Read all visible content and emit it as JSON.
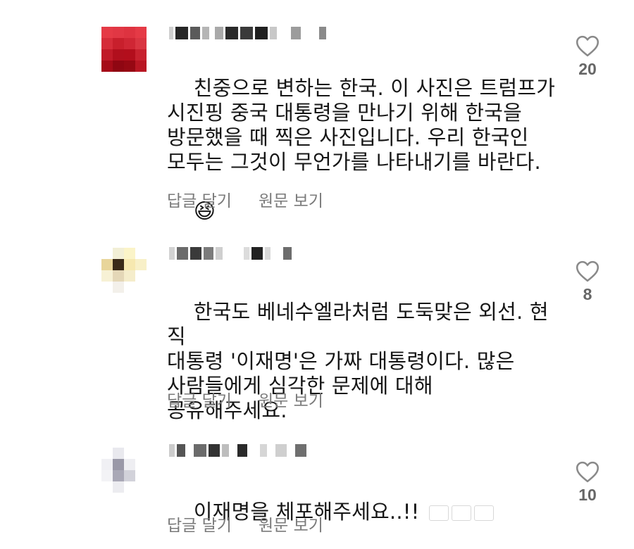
{
  "comments": [
    {
      "text": "친중으로 변하는 한국. 이 사진은 트럼프가\n시진핑 중국 대통령을 만나기 위해 한국을\n방문했을 때 찍은 사진입니다. 우리 한국인\n모두는 그것이 무언가를 나타내기를 바란다.",
      "emoji": "😆",
      "reply": "답글 달기",
      "translate": "원문 보기",
      "likes": "20"
    },
    {
      "text": "한국도 베네수엘라처럼 도둑맞은 외선. 현직\n대통령 '이재명'은 가짜 대통령이다. 많은\n사람들에게 심각한 문제에 대해\n공유해주세요.",
      "reply": "답글 달기",
      "translate": "원문 보기",
      "likes": "8"
    },
    {
      "text": "이재명을 체포해주세요..!! ",
      "flags": [
        "kr-flag-icon",
        "us-flag-icon",
        "jp-flag-icon"
      ],
      "reply": "답글 달기",
      "translate": "원문 보기",
      "likes": "10"
    }
  ],
  "icons": {
    "like": "heart-outline-icon"
  },
  "colors": {
    "text": "#161616",
    "secondary": "#7a7a7a",
    "heart": "#8a8a8a"
  }
}
